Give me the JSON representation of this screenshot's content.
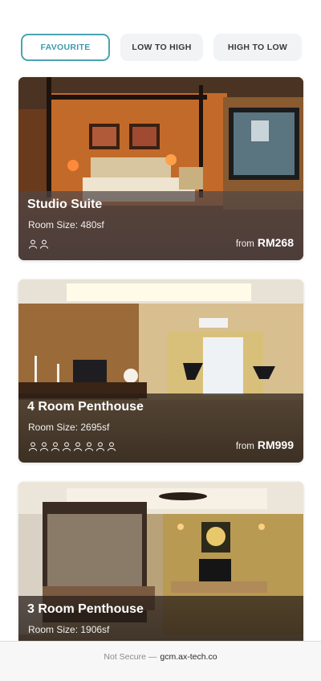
{
  "filters": {
    "favourite": "FAVOURITE",
    "low_to_high": "LOW TO HIGH",
    "high_to_low": "HIGH TO LOW",
    "selected": "FAVOURITE"
  },
  "rooms": [
    {
      "name": "Studio Suite",
      "size": "Room Size: 480sf",
      "guests": 2,
      "price_prefix": "from",
      "price": "RM268"
    },
    {
      "name": "4 Room Penthouse",
      "size": "Room Size: 2695sf",
      "guests": 8,
      "price_prefix": "from",
      "price": "RM999"
    },
    {
      "name": "3 Room Penthouse",
      "size": "Room Size: 1906sf"
    }
  ],
  "browser": {
    "security": "Not Secure —",
    "domain": "gcm.ax-tech.co"
  },
  "colors": {
    "accent": "#4aa3b3",
    "chip_bg": "#f2f3f5"
  }
}
